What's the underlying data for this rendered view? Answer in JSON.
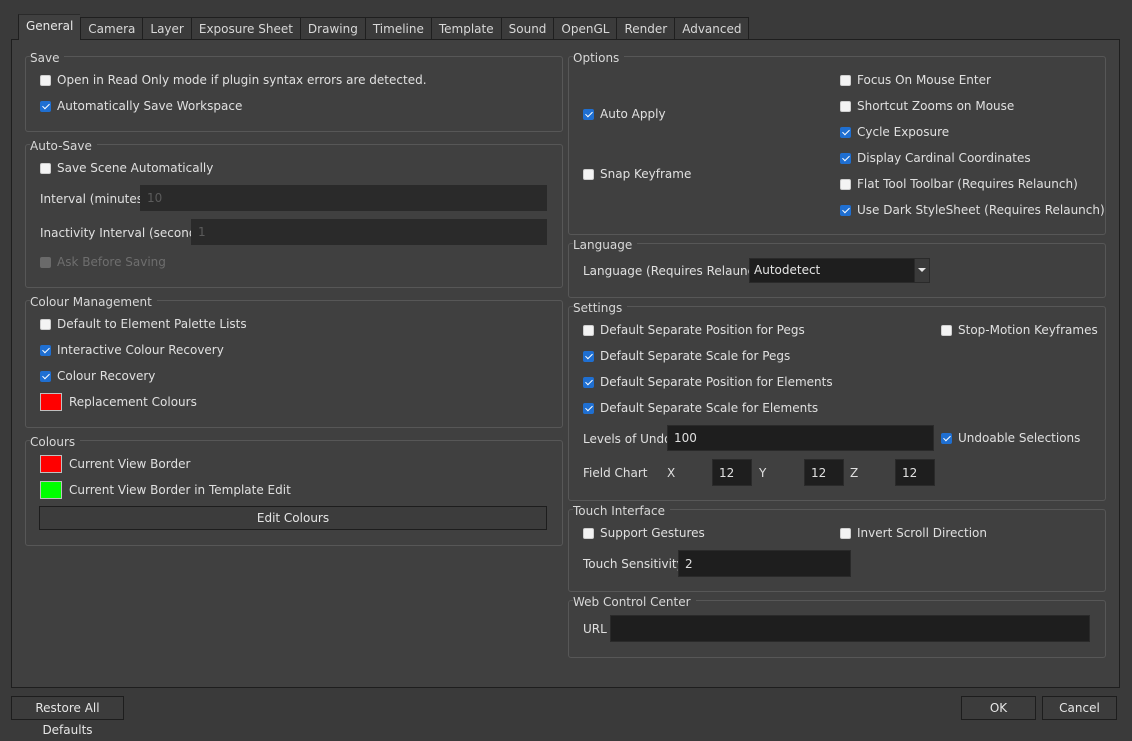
{
  "tabs": [
    "General",
    "Camera",
    "Layer",
    "Exposure Sheet",
    "Drawing",
    "Timeline",
    "Template",
    "Sound",
    "OpenGL",
    "Render",
    "Advanced"
  ],
  "save": {
    "title": "Save",
    "read_only": {
      "label": "Open in Read Only mode if plugin syntax errors are detected.",
      "checked": false
    },
    "auto_save_workspace": {
      "label": "Automatically Save Workspace",
      "checked": true
    }
  },
  "autosave": {
    "title": "Auto-Save",
    "save_scene": {
      "label": "Save Scene Automatically",
      "checked": false
    },
    "interval_label": "Interval (minutes)",
    "interval_value": "10",
    "inactivity_label": "Inactivity Interval (seconds)",
    "inactivity_value": "1",
    "ask_before": {
      "label": "Ask Before Saving",
      "checked": false
    }
  },
  "colour_mgmt": {
    "title": "Colour Management",
    "default_palette": {
      "label": "Default to Element Palette Lists",
      "checked": false
    },
    "interactive_recovery": {
      "label": "Interactive Colour Recovery",
      "checked": true
    },
    "colour_recovery": {
      "label": "Colour Recovery",
      "checked": true
    },
    "replacement": {
      "label": "Replacement Colours",
      "color": "#ff0000"
    }
  },
  "colours": {
    "title": "Colours",
    "view_border": {
      "label": "Current View Border",
      "color": "#ff0000"
    },
    "view_border_template": {
      "label": "Current View Border in Template Edit",
      "color": "#00ff00"
    },
    "edit_button": "Edit Colours"
  },
  "options": {
    "title": "Options",
    "auto_apply": {
      "label": "Auto Apply",
      "checked": true
    },
    "snap_keyframe": {
      "label": "Snap Keyframe",
      "checked": false
    },
    "focus_mouse": {
      "label": "Focus On Mouse Enter",
      "checked": false
    },
    "shortcut_zooms": {
      "label": "Shortcut Zooms on Mouse",
      "checked": false
    },
    "cycle_exposure": {
      "label": "Cycle Exposure",
      "checked": true
    },
    "cardinal": {
      "label": "Display Cardinal Coordinates",
      "checked": true
    },
    "flat_toolbar": {
      "label": "Flat Tool Toolbar (Requires Relaunch)",
      "checked": false
    },
    "dark_stylesheet": {
      "label": "Use Dark StyleSheet (Requires Relaunch)",
      "checked": true
    }
  },
  "language": {
    "title": "Language",
    "label": "Language (Requires Relaunch)",
    "value": "Autodetect"
  },
  "settings": {
    "title": "Settings",
    "sep_pos_pegs": {
      "label": "Default Separate Position for Pegs",
      "checked": false
    },
    "sep_scale_pegs": {
      "label": "Default Separate Scale for Pegs",
      "checked": true
    },
    "sep_pos_elements": {
      "label": "Default Separate Position for Elements",
      "checked": true
    },
    "sep_scale_elements": {
      "label": "Default Separate Scale for Elements",
      "checked": true
    },
    "stop_motion": {
      "label": "Stop-Motion Keyframes",
      "checked": false
    },
    "undo_label": "Levels of Undo",
    "undo_value": "100",
    "undoable_sel": {
      "label": "Undoable Selections",
      "checked": true
    },
    "field_chart_label": "Field Chart",
    "x_label": "X",
    "x_value": "12",
    "y_label": "Y",
    "y_value": "12",
    "z_label": "Z",
    "z_value": "12"
  },
  "touch": {
    "title": "Touch Interface",
    "gestures": {
      "label": "Support Gestures",
      "checked": false
    },
    "invert_scroll": {
      "label": "Invert Scroll Direction",
      "checked": false
    },
    "sensitivity_label": "Touch Sensitivity",
    "sensitivity_value": "2"
  },
  "web": {
    "title": "Web Control Center",
    "url_label": "URL",
    "url_value": ""
  },
  "footer": {
    "restore": "Restore All Defaults",
    "ok": "OK",
    "cancel": "Cancel"
  }
}
